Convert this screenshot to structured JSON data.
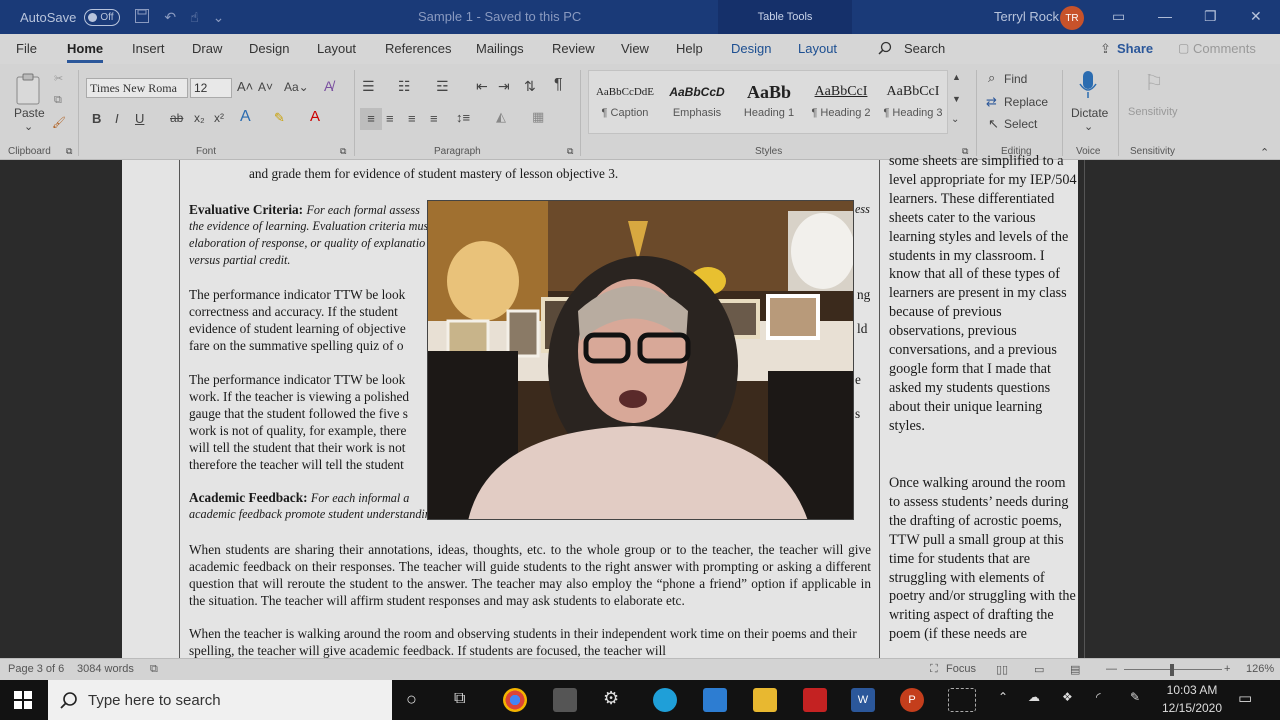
{
  "titlebar": {
    "autosave_label": "AutoSave",
    "autosave_state": "Off",
    "doc_title": "Sample 1  -  Saved to this PC",
    "table_tools": "Table Tools",
    "user_name": "Terryl Rock",
    "user_initials": "TR"
  },
  "tabs": [
    "File",
    "Home",
    "Insert",
    "Draw",
    "Design",
    "Layout",
    "References",
    "Mailings",
    "Review",
    "View",
    "Help",
    "Design",
    "Layout"
  ],
  "search_label": "Search",
  "share_label": "Share",
  "comments_label": "Comments",
  "ribbon": {
    "paste": "Paste",
    "font_name": "Times New Roma",
    "font_size": "12",
    "styles": [
      {
        "sample": "AaBbCcDdE",
        "name": "¶ Caption"
      },
      {
        "sample": "AaBbCcD",
        "name": "Emphasis"
      },
      {
        "sample": "AaBb",
        "name": "Heading 1"
      },
      {
        "sample": "AaBbCcI",
        "name": "¶ Heading 2"
      },
      {
        "sample": "AaBbCcI",
        "name": "¶ Heading 3"
      }
    ],
    "find": "Find",
    "replace": "Replace",
    "select": "Select",
    "dictate": "Dictate",
    "sensitivity": "Sensitivity",
    "groups": {
      "clipboard": "Clipboard",
      "font": "Font",
      "paragraph": "Paragraph",
      "styles": "Styles",
      "editing": "Editing",
      "voice": "Voice",
      "sensitivity": "Sensitivity"
    }
  },
  "document": {
    "top_line": "and grade them for evidence of student mastery of lesson objective 3.",
    "eval_heading": "Evaluative Criteria:",
    "eval_note_lines": [
      "For each formal assess",
      "the evidence of learning. Evaluation criteria mus",
      "elaboration of response, or quality of explanatio",
      "versus partial credit."
    ],
    "eval_note_right": "ess",
    "p1_lines": [
      "The performance indicator TTW be look",
      "correctness and accuracy. If the student",
      "evidence of student learning of objective",
      "fare on the summative spelling quiz of o"
    ],
    "p1_right": [
      "ng",
      "",
      "ld",
      ""
    ],
    "p2_lines": [
      "The performance indicator TTW be look",
      "work. If the teacher is viewing a polished",
      "gauge that the student followed the five s",
      "work is not of quality, for example, there",
      "will tell the student that their work is not",
      "therefore the teacher will tell the student"
    ],
    "p2_right": [
      "e",
      "",
      "s",
      "",
      "",
      ""
    ],
    "acad_heading": "Academic Feedback:",
    "acad_note_lines": [
      "For each informal a",
      "academic feedback promote student understandin"
    ],
    "p3": "When students are sharing their annotations, ideas, thoughts, etc. to the whole group or to the teacher, the teacher will give academic feedback on their responses. The teacher will guide students to the right answer with prompting or asking a different question that will reroute the student to the answer. The teacher may also employ the “phone a friend” option if applicable in the situation. The teacher will affirm student responses and may ask students to elaborate etc.",
    "p4": "When the teacher is walking around the room and observing students in their independent work time on their poems and their spelling, the teacher will give academic feedback. If students are focused, the teacher will",
    "side_p1": "some sheets are simplified to a level appropriate for my IEP/504 learners. These differentiated sheets cater to the various learning styles and levels of the students in my classroom. I know that all of these types of learners are present in my class because of previous observations, previous conversations, and a previous google form that I made that asked my students questions about their unique learning styles.",
    "side_p2": "Once walking around the room to assess students’ needs during the drafting of acrostic poems, TTW pull a small group at this time for students that are struggling with elements of poetry and/or struggling with the writing aspect of drafting the poem (if these needs are"
  },
  "statusbar": {
    "page": "Page 3 of 6",
    "words": "3084 words",
    "focus": "Focus",
    "zoom": "126%"
  },
  "taskbar": {
    "search_placeholder": "Type here to search",
    "time": "10:03 AM",
    "date": "12/15/2020"
  },
  "colors": {
    "titlebar": "#1a3a78",
    "accent": "#2b579a",
    "avatar": "#c7522a"
  }
}
